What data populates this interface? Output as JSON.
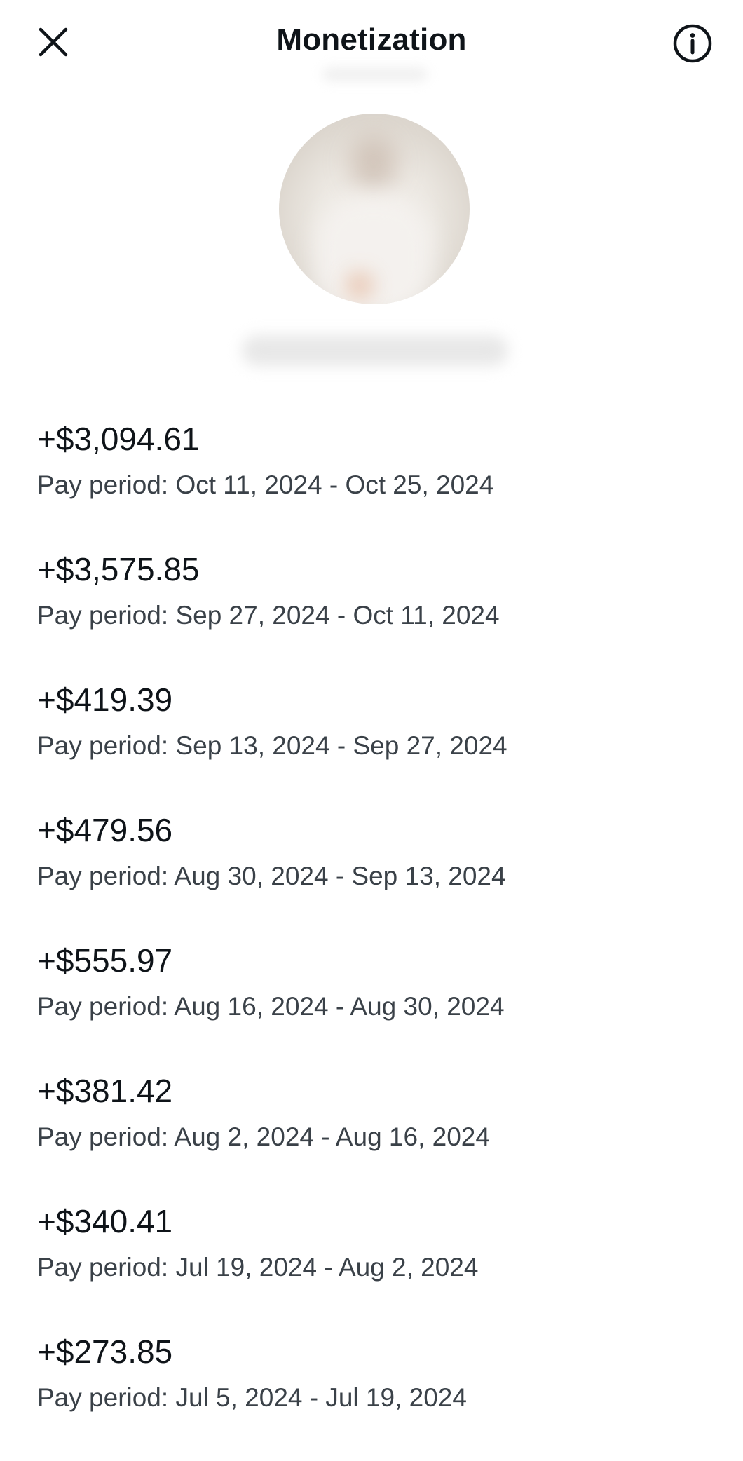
{
  "header": {
    "title": "Monetization",
    "close_icon": "close-icon",
    "info_icon": "info-icon"
  },
  "colors": {
    "text_primary": "#0f1419",
    "text_secondary": "#3a4148",
    "background": "#ffffff"
  },
  "payouts": [
    {
      "amount": "+$3,094.61",
      "period": "Pay period: Oct 11, 2024 - Oct 25, 2024"
    },
    {
      "amount": "+$3,575.85",
      "period": "Pay period: Sep 27, 2024 - Oct 11, 2024"
    },
    {
      "amount": "+$419.39",
      "period": "Pay period: Sep 13, 2024 - Sep 27, 2024"
    },
    {
      "amount": "+$479.56",
      "period": "Pay period: Aug 30, 2024 - Sep 13, 2024"
    },
    {
      "amount": "+$555.97",
      "period": "Pay period: Aug 16, 2024 - Aug 30, 2024"
    },
    {
      "amount": "+$381.42",
      "period": "Pay period: Aug 2, 2024 - Aug 16, 2024"
    },
    {
      "amount": "+$340.41",
      "period": "Pay period: Jul 19, 2024 - Aug 2, 2024"
    },
    {
      "amount": "+$273.85",
      "period": "Pay period: Jul 5, 2024 - Jul 19, 2024"
    }
  ]
}
